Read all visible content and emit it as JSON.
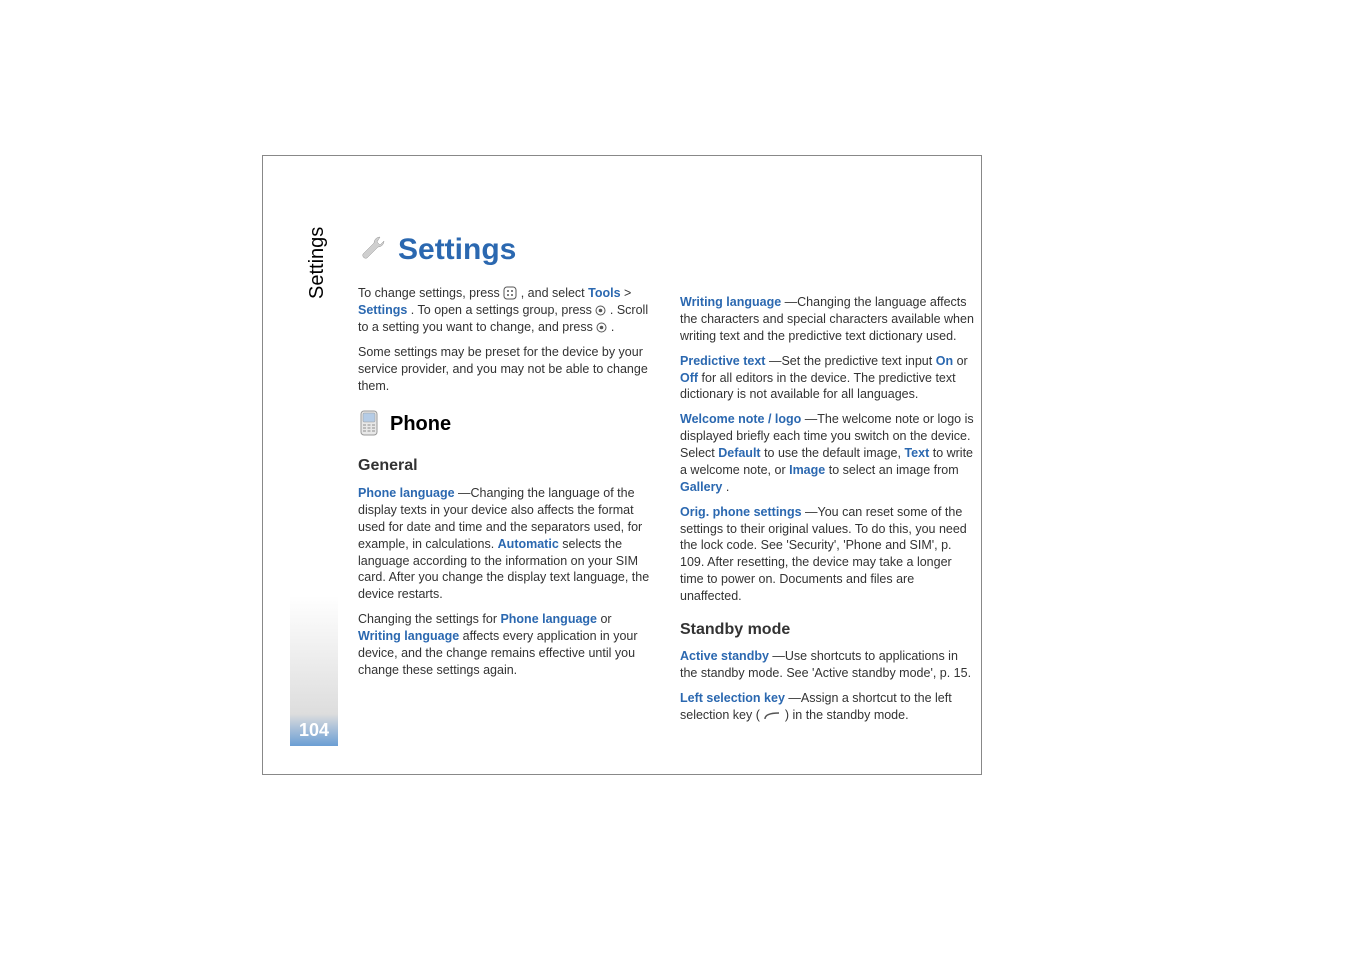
{
  "sidebar_label": "Settings",
  "page_number": "104",
  "title": "Settings",
  "intro": {
    "p1a": "To change settings, press ",
    "p1b": ", and select ",
    "tools": "Tools",
    "gt": " > ",
    "settings": "Settings",
    "p1c": ". To open a settings group, press ",
    "p1d": ". Scroll to a setting you want to change, and press ",
    "p1e": ".",
    "p2": "Some settings may be preset for the device by your service provider, and you may not be able to change them."
  },
  "phone": {
    "heading": "Phone",
    "general": {
      "heading": "General",
      "phone_language_label": "Phone language",
      "phone_language_text_a": "—Changing the language of the display texts in your device also affects the format used for date and time and the separators used, for example, in calculations. ",
      "automatic": "Automatic",
      "phone_language_text_b": " selects the language according to the information on your SIM card. After you change the display text language, the device restarts.",
      "changing_a": "Changing the settings for ",
      "changing_b": " or ",
      "writing_language": "Writing language",
      "changing_c": " affects every application in your device, and the change remains effective until you change these settings again.",
      "writing_language_label": "Writing language",
      "writing_language_text": "—Changing the language affects the characters and special characters available when writing text and the predictive text dictionary used.",
      "predictive_label": "Predictive text",
      "predictive_a": "—Set the predictive text input ",
      "on": "On",
      "predictive_b": " or ",
      "off": "Off",
      "predictive_c": " for all editors in the device. The predictive text dictionary is not available for all languages.",
      "welcome_label": "Welcome note / logo",
      "welcome_a": "—The welcome note or logo is displayed briefly each time you switch on the device. Select ",
      "default": "Default",
      "welcome_b": " to use the default image, ",
      "text": "Text",
      "welcome_c": " to write a welcome note, or ",
      "image": "Image",
      "welcome_d": " to select an image from ",
      "gallery": "Gallery",
      "welcome_e": ".",
      "orig_label": "Orig. phone settings",
      "orig_text": "—You can reset some of the settings to their original values. To do this, you need the lock code. See 'Security', 'Phone and SIM', p. 109. After resetting, the device may take a longer time to power on. Documents and files are unaffected."
    },
    "standby": {
      "heading": "Standby mode",
      "active_label": "Active standby",
      "active_text": "—Use shortcuts to applications in the standby mode. See 'Active standby mode', p. 15.",
      "left_label": "Left selection key",
      "left_a": "—Assign a shortcut to the left selection key (",
      "left_b": ") in the standby mode."
    }
  }
}
